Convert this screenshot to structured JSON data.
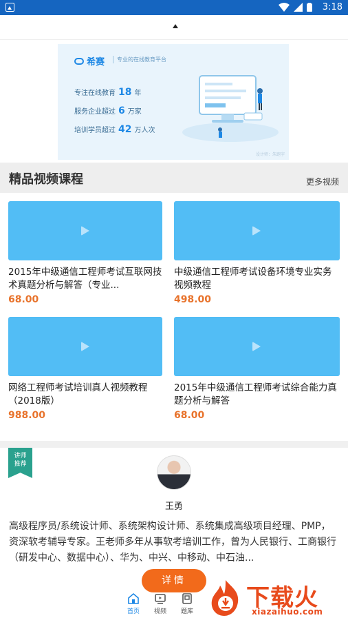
{
  "status_bar": {
    "time": "3:18"
  },
  "banner": {
    "logo_text": "希赛",
    "slogan": "专业的在线教育平台",
    "stats": [
      {
        "prefix": "专注在线教育",
        "num": "18",
        "suffix": "年"
      },
      {
        "prefix": "服务企业超过",
        "num": "6",
        "suffix": "万家"
      },
      {
        "prefix": "培训学员超过",
        "num": "42",
        "suffix": "万人次"
      }
    ],
    "credit": "设计师：朱跑字"
  },
  "section": {
    "title": "精品视频课程",
    "more": "更多视频"
  },
  "courses": [
    {
      "title": "2015年中级通信工程师考试互联网技术真题分析与解答（专业...",
      "price": "68.00"
    },
    {
      "title": "中级通信工程师考试设备环境专业实务视频教程",
      "price": "498.00"
    },
    {
      "title": "网络工程师考试培训真人视频教程（2018版）",
      "price": "988.00"
    },
    {
      "title": "2015年中级通信工程师考试综合能力真题分析与解答",
      "price": "68.00"
    }
  ],
  "teacher": {
    "badge_line1": "讲师",
    "badge_line2": "推荐",
    "name": "王勇",
    "bio": "高级程序员/系统设计师、系统架构设计师、系统集成高级项目经理、PMP，资深软考辅导专家。王老师多年从事软考培训工作，曾为人民银行、工商银行（研发中心、数据中心）、华为、中兴、中移动、中石油...",
    "detail_button": "详情"
  },
  "bottom_nav": [
    {
      "label": "首页",
      "icon": "home-icon",
      "active": true
    },
    {
      "label": "视频",
      "icon": "video-icon",
      "active": false
    },
    {
      "label": "题库",
      "icon": "question-bank-icon",
      "active": false
    }
  ],
  "watermark": {
    "cn": "下载火",
    "en": "xiazaihuo.com"
  },
  "colors": {
    "status_bar": "#1565c0",
    "thumb": "#52bdf5",
    "price": "#e8732c",
    "accent_button": "#f26a1b",
    "nav_active": "#1e88e5",
    "badge": "#2aa18e"
  }
}
